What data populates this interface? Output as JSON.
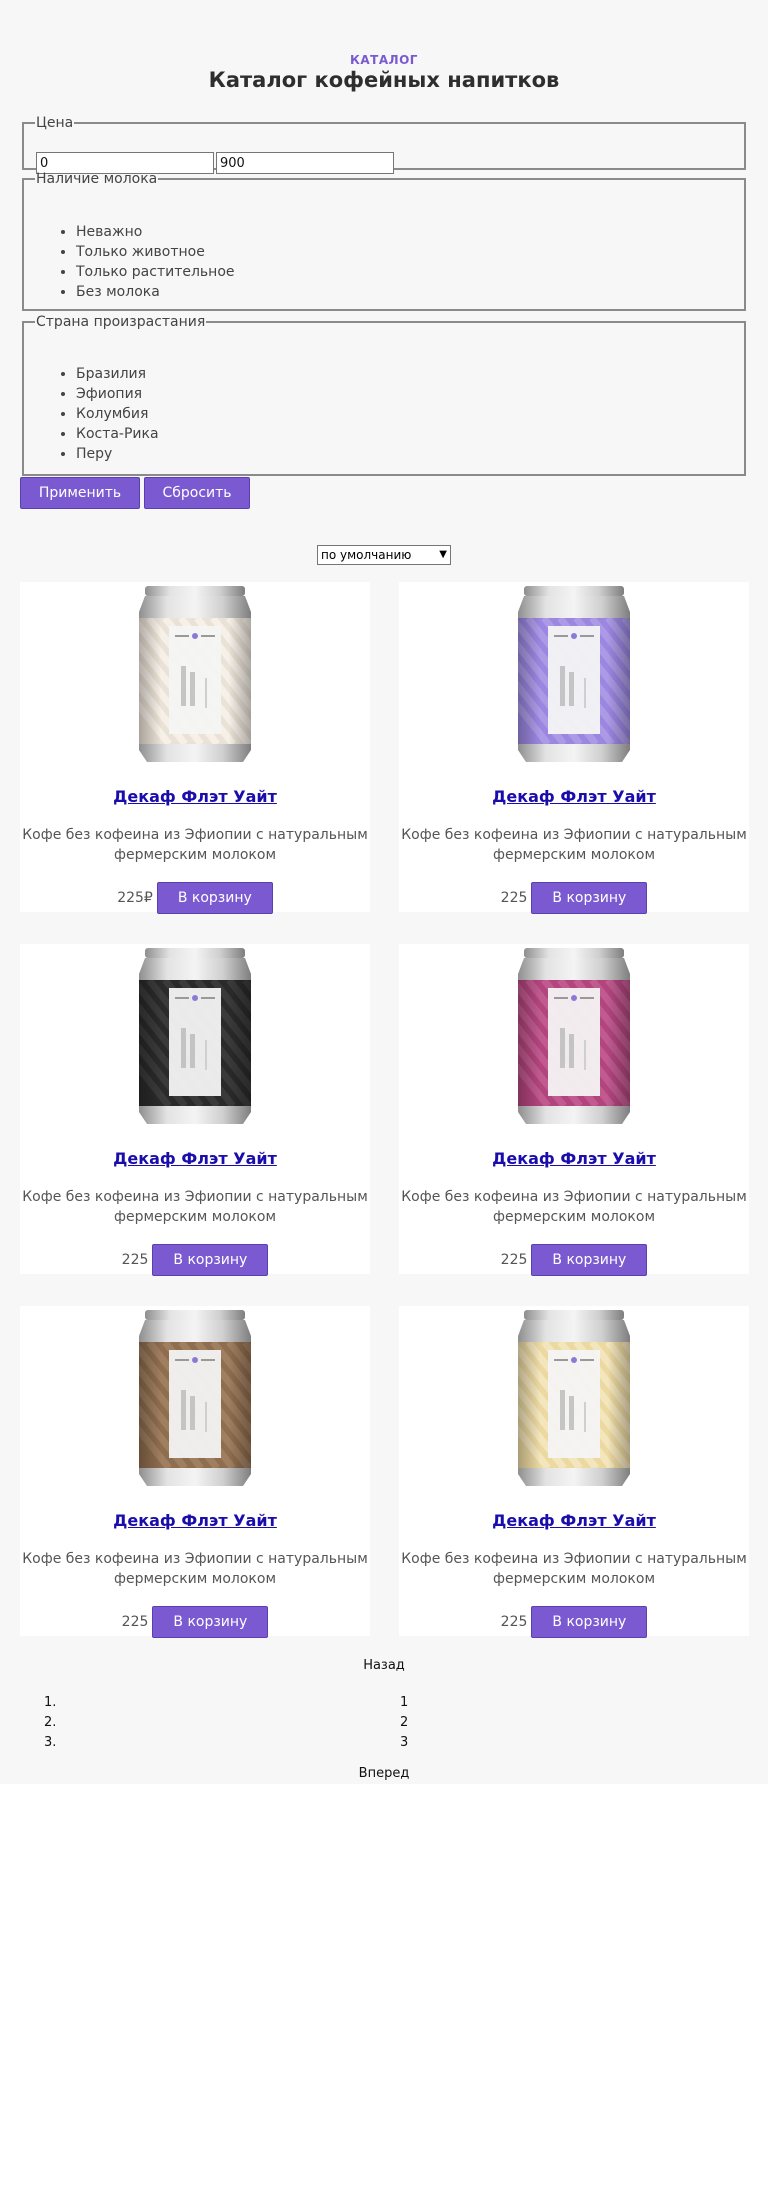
{
  "header": {
    "eyebrow": "КАТАЛОГ",
    "title": "Каталог кофейных напитков"
  },
  "filters": {
    "price": {
      "legend": "Цена",
      "from_value": "0",
      "to_value": "900"
    },
    "milk": {
      "legend": "Наличие молока",
      "options": [
        "Неважно",
        "Только животное",
        "Только растительное",
        "Без молока"
      ]
    },
    "country": {
      "legend": "Страна произрастания",
      "options": [
        "Бразилия",
        "Эфиопия",
        "Колумбия",
        "Коста-Рика",
        "Перу"
      ]
    },
    "apply_label": "Применить",
    "reset_label": "Сбросить"
  },
  "sort": {
    "selected": "по умолчанию"
  },
  "products": [
    {
      "name": "Декаф Флэт Уайт",
      "description": "Кофе без кофеина из Эфиопии с натуральным фермерским молоком",
      "price": "225₽",
      "cart_label": "В корзину",
      "can_color": "#eae2d6",
      "stripe_color": "#f6f0e8"
    },
    {
      "name": "Декаф Флэт Уайт",
      "description": "Кофе без кофеина из Эфиопии с натуральным фермерским молоком",
      "price": "225",
      "cart_label": "В корзину",
      "can_color": "#9b86e0",
      "stripe_color": "#ac9ae6"
    },
    {
      "name": "Декаф Флэт Уайт",
      "description": "Кофе без кофеина из Эфиопии с натуральным фермерским молоком",
      "price": "225",
      "cart_label": "В корзину",
      "can_color": "#2a2a2a",
      "stripe_color": "#3a3a3a"
    },
    {
      "name": "Декаф Флэт Уайт",
      "description": "Кофе без кофеина из Эфиопии с натуральным фермерским молоком",
      "price": "225",
      "cart_label": "В корзину",
      "can_color": "#b2457e",
      "stripe_color": "#c05a8f"
    },
    {
      "name": "Декаф Флэт Уайт",
      "description": "Кофе без кофеина из Эфиопии с натуральным фермерским молоком",
      "price": "225",
      "cart_label": "В корзину",
      "can_color": "#8f6d4f",
      "stripe_color": "#a07e60"
    },
    {
      "name": "Декаф Флэт Уайт",
      "description": "Кофе без кофеина из Эфиопии с натуральным фермерским молоком",
      "price": "225",
      "cart_label": "В корзину",
      "can_color": "#ecd9a2",
      "stripe_color": "#f4e6bc"
    }
  ],
  "pagination": {
    "back_label": "Назад",
    "pages": [
      "1",
      "2",
      "3"
    ],
    "next_label": "Вперед"
  }
}
